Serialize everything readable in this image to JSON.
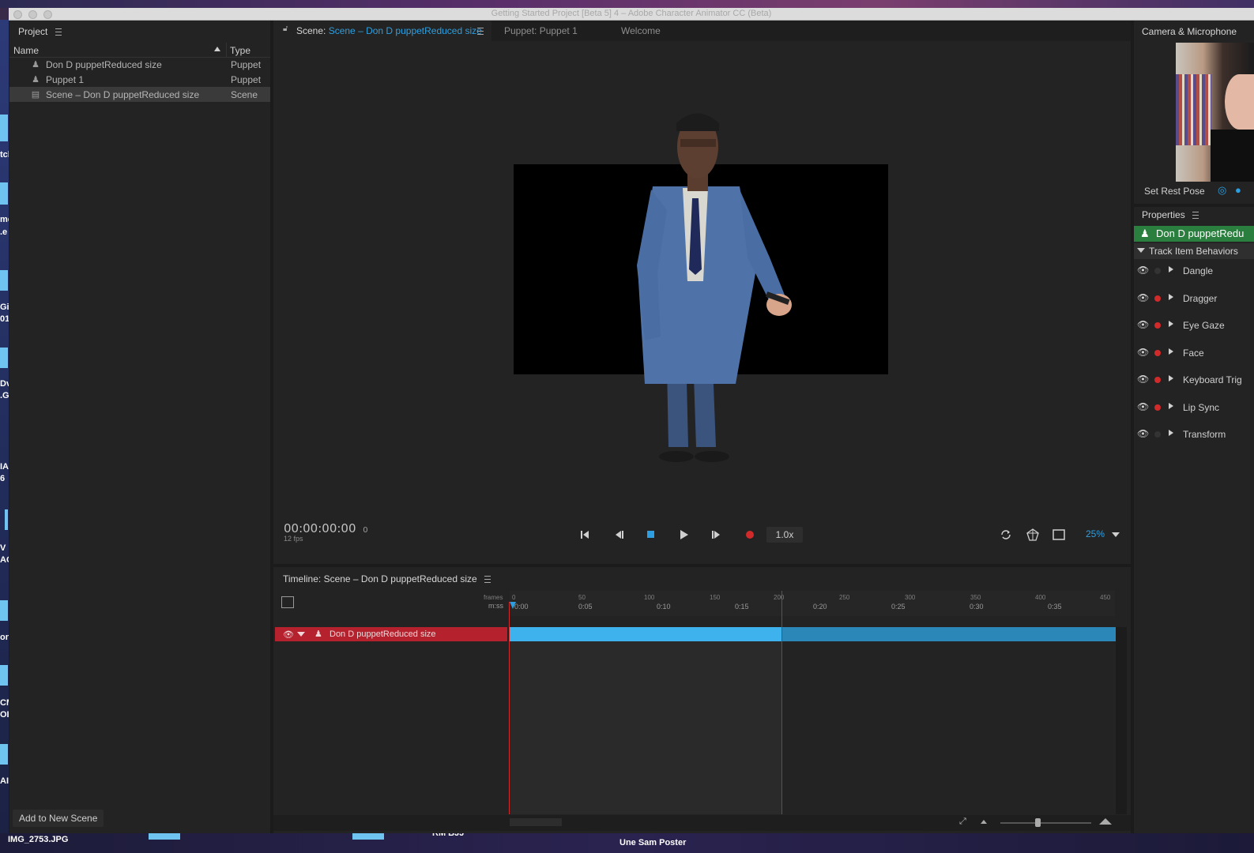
{
  "window": {
    "title": "Getting Started Project [Beta 5] 4 – Adobe Character Animator CC (Beta)"
  },
  "desktop": {
    "left_fragments": [
      "tcl",
      "me",
      ".e",
      "Gi",
      "01",
      "Dv",
      ".G",
      "IA",
      "6",
      "V",
      "AG",
      "on",
      "CM",
      "OI",
      "AI"
    ],
    "bottom_labels": [
      "IMG_2753.JPG",
      "RM BJJ",
      "Une Sam Poster"
    ]
  },
  "project": {
    "title": "Project",
    "col_name": "Name",
    "col_type": "Type",
    "items": [
      {
        "name": "Don D puppetReduced size",
        "type": "Puppet"
      },
      {
        "name": "Puppet 1",
        "type": "Puppet"
      },
      {
        "name": "Scene – Don D puppetReduced size",
        "type": "Scene"
      }
    ],
    "add_button": "Add to New Scene"
  },
  "tabs": {
    "scene_prefix": "Scene:",
    "scene_name": "Scene – Don D puppetReduced size",
    "puppet": "Puppet: Puppet 1",
    "welcome": "Welcome"
  },
  "scene": {
    "timecode": "00:00:00:00",
    "frame": "0",
    "fps": "12 fps",
    "speed": "1.0x",
    "zoom": "25%"
  },
  "timeline": {
    "title": "Timeline: Scene – Don D puppetReduced size",
    "frames_label": "frames",
    "mss_label": "m:ss",
    "frame_ticks": [
      "0",
      "50",
      "100",
      "150",
      "200",
      "250",
      "300",
      "350",
      "400",
      "450"
    ],
    "time_ticks": [
      "0:00",
      "0:05",
      "0:10",
      "0:15",
      "0:20",
      "0:25",
      "0:30",
      "0:35"
    ],
    "track_name": "Don D puppetReduced size"
  },
  "camera": {
    "title": "Camera & Microphone",
    "rest_pose": "Set Rest Pose"
  },
  "properties": {
    "title": "Properties",
    "puppet_name": "Don D puppetRedu",
    "section": "Track Item Behaviors",
    "behaviors": [
      {
        "label": "Dangle",
        "armed": false
      },
      {
        "label": "Dragger",
        "armed": true
      },
      {
        "label": "Eye Gaze",
        "armed": true
      },
      {
        "label": "Face",
        "armed": true
      },
      {
        "label": "Keyboard Trig",
        "armed": true
      },
      {
        "label": "Lip Sync",
        "armed": true
      },
      {
        "label": "Transform",
        "armed": false
      }
    ]
  },
  "colors": {
    "accent": "#2d9fe0",
    "track": "#b5222e",
    "bar": "#3db2ec",
    "record": "#d12a2a"
  }
}
